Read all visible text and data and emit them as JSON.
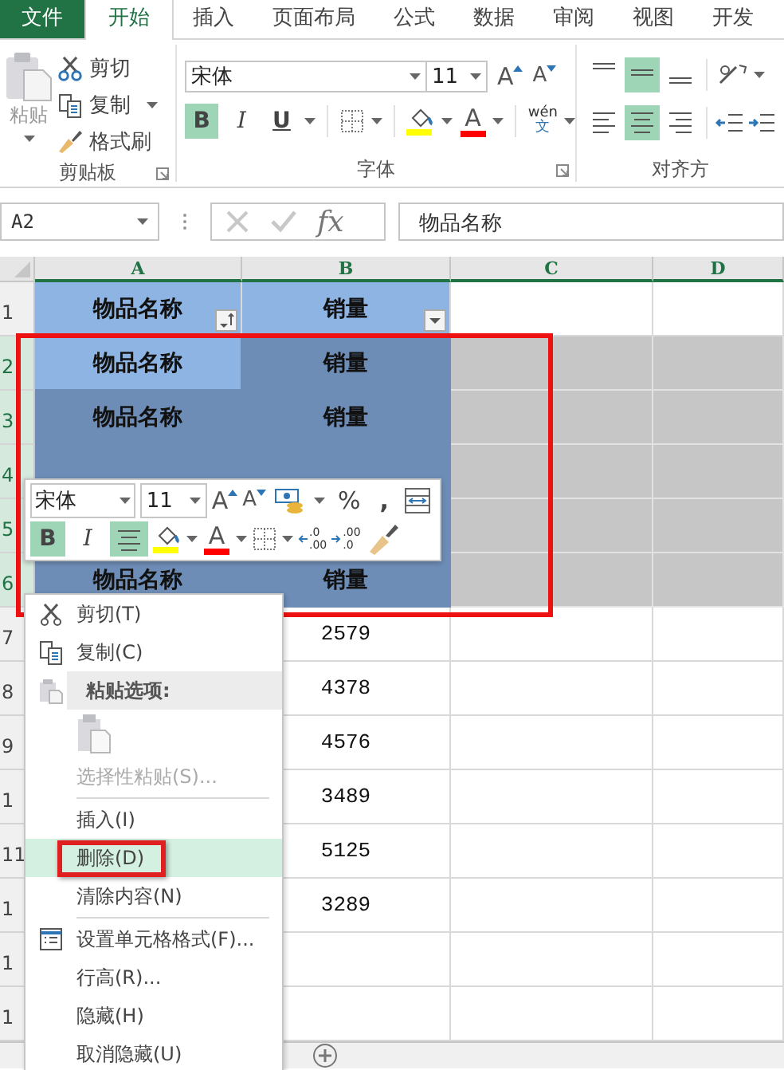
{
  "tabs": [
    {
      "label": "文件",
      "kind": "file",
      "selected": false
    },
    {
      "label": "开始",
      "kind": "tab",
      "selected": true
    },
    {
      "label": "插入",
      "kind": "tab",
      "selected": false
    },
    {
      "label": "页面布局",
      "kind": "tab",
      "selected": false
    },
    {
      "label": "公式",
      "kind": "tab",
      "selected": false
    },
    {
      "label": "数据",
      "kind": "tab",
      "selected": false
    },
    {
      "label": "审阅",
      "kind": "tab",
      "selected": false
    },
    {
      "label": "视图",
      "kind": "tab",
      "selected": false
    },
    {
      "label": "开发",
      "kind": "tab",
      "selected": false
    }
  ],
  "clipboard": {
    "label": "剪贴板",
    "paste": "粘贴",
    "cut": "剪切",
    "copy": "复制",
    "format_painter": "格式刷"
  },
  "font": {
    "label": "字体",
    "font_name": "宋体",
    "font_size": "11",
    "grow": "A",
    "shrink": "A",
    "bold": {
      "label": "B",
      "selected": true
    },
    "italic": {
      "label": "I",
      "selected": false
    },
    "underline": {
      "label": "U",
      "selected": false
    },
    "font_color": "A",
    "phonetic_top": "wén",
    "phonetic_bottom": "文"
  },
  "alignment": {
    "label": "对齐方",
    "buttons": [
      {
        "kind": "top",
        "selected": false
      },
      {
        "kind": "middle",
        "selected": true
      },
      {
        "kind": "bottom",
        "selected": false
      },
      {
        "kind": "left",
        "selected": false
      },
      {
        "kind": "center",
        "selected": true
      },
      {
        "kind": "right",
        "selected": false
      }
    ]
  },
  "formula_bar": {
    "name_box": "A2",
    "function_label": "fx",
    "value": "物品名称"
  },
  "columns": [
    {
      "label": "A"
    },
    {
      "label": "B"
    },
    {
      "label": "C"
    },
    {
      "label": "D"
    }
  ],
  "rows": [
    {
      "number": "1",
      "kind": "header",
      "selected": false,
      "a": {
        "text": "物品名称",
        "active": false,
        "sorted": true
      },
      "b": {
        "text": "销量",
        "active": false,
        "sorted": false
      }
    },
    {
      "number": "2",
      "kind": "label",
      "selected": true,
      "a": {
        "text": "物品名称",
        "active": true
      },
      "b": {
        "text": "销量",
        "active": false
      }
    },
    {
      "number": "3",
      "kind": "label",
      "selected": true,
      "a": {
        "text": "物品名称",
        "active": false
      },
      "b": {
        "text": "销量",
        "active": false
      }
    },
    {
      "number": "4",
      "kind": "label",
      "selected": true
    },
    {
      "number": "5",
      "kind": "label",
      "selected": true
    },
    {
      "number": "6",
      "kind": "label",
      "selected": true,
      "a": {
        "text": "物品名称",
        "active": false
      },
      "b": {
        "text": "销量",
        "active": false
      }
    },
    {
      "number": "7",
      "kind": "data",
      "selected": false,
      "b": {
        "text": "2579",
        "active": false
      }
    },
    {
      "number": "8",
      "kind": "data",
      "selected": false,
      "b": {
        "text": "4378",
        "active": false
      }
    },
    {
      "number": "9",
      "kind": "data",
      "selected": false,
      "b": {
        "text": "4576",
        "active": false
      }
    },
    {
      "number": "1",
      "kind": "data",
      "selected": false,
      "b": {
        "text": "3489",
        "active": false
      }
    },
    {
      "number": "11",
      "kind": "data",
      "selected": false,
      "b": {
        "text": "5125",
        "active": false
      }
    },
    {
      "number": "1",
      "kind": "data",
      "selected": false,
      "b": {
        "text": "3289",
        "active": false
      }
    },
    {
      "number": "1",
      "kind": "data",
      "selected": false
    },
    {
      "number": "1",
      "kind": "data",
      "selected": false
    }
  ],
  "selection_frame": true,
  "mini_toolbar": {
    "font_name": "宋体",
    "font_size": "11",
    "grow": "A",
    "shrink": "A",
    "percent": "%",
    "comma": ",",
    "bold": {
      "label": "B",
      "selected": true
    },
    "italic": {
      "label": "I",
      "selected": false
    },
    "center": {
      "selected": true
    },
    "font_color": "A",
    "increase_decimal": [
      ".0",
      ".00"
    ],
    "decrease_decimal": [
      ".00",
      ".0"
    ]
  },
  "context_menu": [
    {
      "kind": "cut",
      "label": "剪切(T)",
      "selected": false,
      "disabled": false,
      "highlight": false
    },
    {
      "kind": "copy",
      "label": "复制(C)",
      "selected": false,
      "disabled": false,
      "highlight": false
    },
    {
      "kind": "paste_header",
      "label": "粘贴选项:"
    },
    {
      "kind": "paste_option"
    },
    {
      "kind": "item",
      "label": "选择性粘贴(S)...",
      "selected": false,
      "disabled": true,
      "highlight": false
    },
    {
      "kind": "separator"
    },
    {
      "kind": "item",
      "label": "插入(I)",
      "selected": false,
      "disabled": false,
      "highlight": false
    },
    {
      "kind": "item",
      "label": "删除(D)",
      "selected": true,
      "disabled": false,
      "highlight": true
    },
    {
      "kind": "item",
      "label": "清除内容(N)",
      "selected": false,
      "disabled": false,
      "highlight": false
    },
    {
      "kind": "separator"
    },
    {
      "kind": "format_cells",
      "label": "设置单元格格式(F)...",
      "selected": false,
      "disabled": false,
      "highlight": false
    },
    {
      "kind": "item",
      "label": "行高(R)...",
      "selected": false,
      "disabled": false,
      "highlight": false
    },
    {
      "kind": "item",
      "label": "隐藏(H)",
      "selected": false,
      "disabled": false,
      "highlight": false
    },
    {
      "kind": "item",
      "label": "取消隐藏(U)",
      "selected": false,
      "disabled": false,
      "highlight": false
    }
  ]
}
